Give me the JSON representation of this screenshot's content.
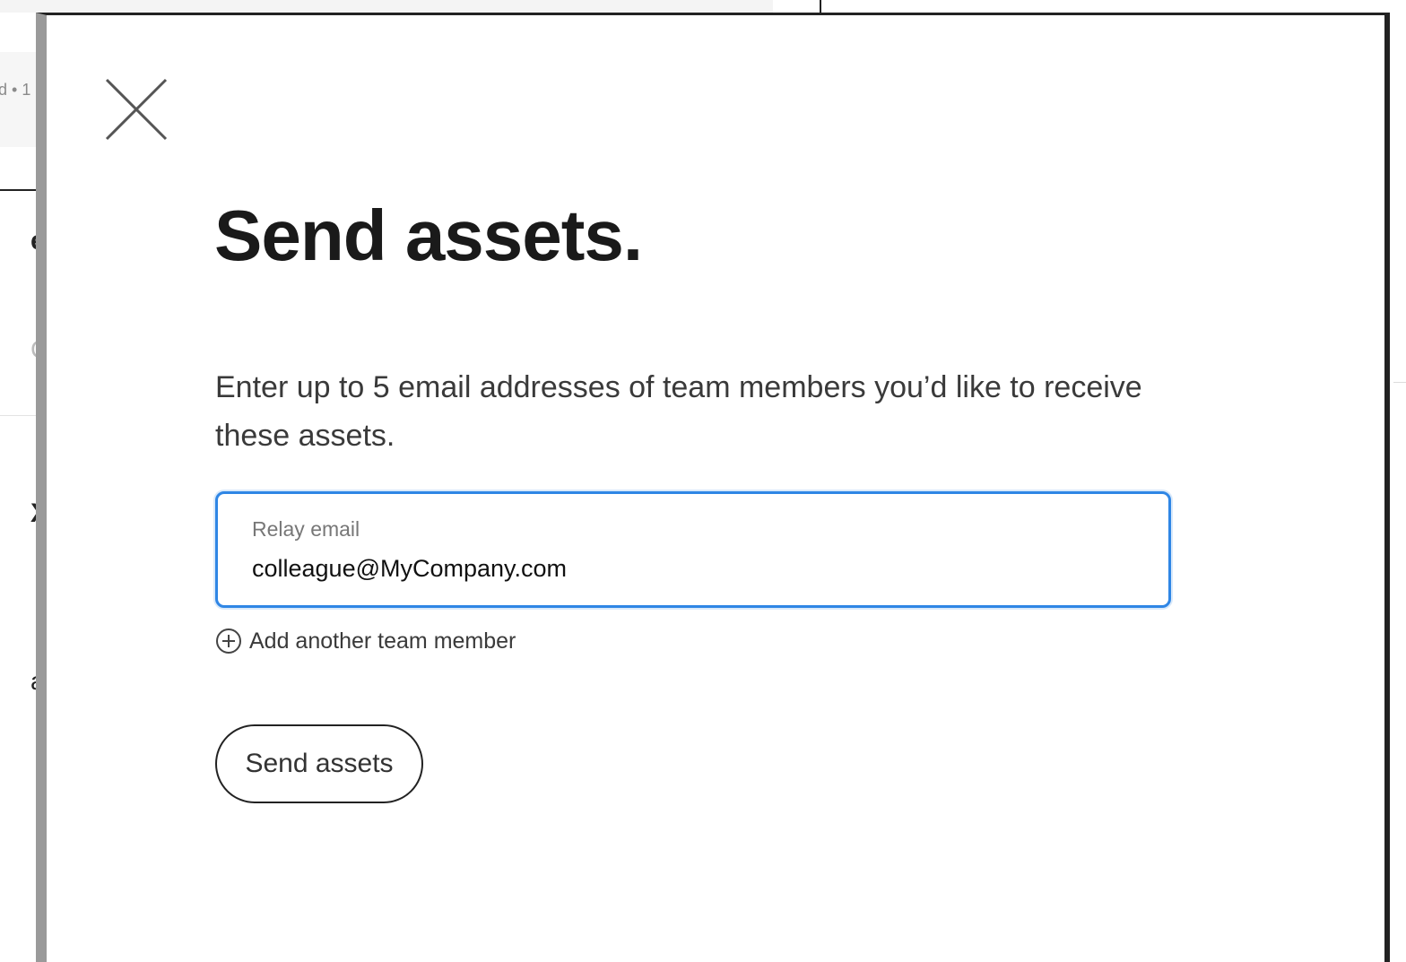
{
  "background": {
    "card_text": "d • 1",
    "fragments": [
      "e",
      "C",
      "X",
      "a"
    ]
  },
  "modal": {
    "close_icon": "close-icon",
    "title": "Send assets.",
    "description": "Enter up to 5 email addresses of team members you’d like to receive these assets.",
    "email_field": {
      "label": "Relay email",
      "value": "colleague@MyCompany.com"
    },
    "add_member": {
      "icon": "plus-circle-icon",
      "label": "Add another team member"
    },
    "send_button_label": "Send assets"
  },
  "colors": {
    "focus_border": "#2f86e5",
    "title_text": "#1a1a1a",
    "body_text": "#3a3a3a"
  }
}
